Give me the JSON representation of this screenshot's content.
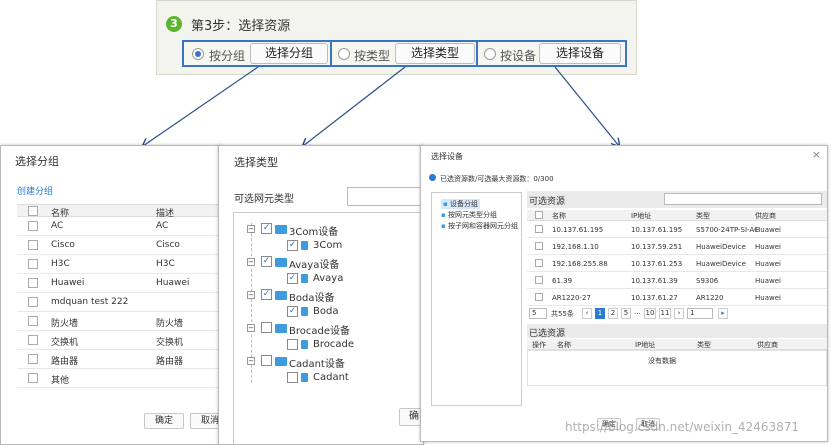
{
  "banner": {
    "step_number": "3",
    "title": "第3步：选择资源",
    "options": [
      {
        "label": "按分组",
        "button": "选择分组",
        "selected": true
      },
      {
        "label": "按类型",
        "button": "选择类型",
        "selected": false
      },
      {
        "label": "按设备",
        "button": "选择设备",
        "selected": false
      }
    ]
  },
  "group_dialog": {
    "title": "选择分组",
    "create_link": "创建分组",
    "columns": [
      "名称",
      "描述"
    ],
    "rows": [
      {
        "name": "AC",
        "desc": "AC"
      },
      {
        "name": "Cisco",
        "desc": "Cisco"
      },
      {
        "name": "H3C",
        "desc": "H3C"
      },
      {
        "name": "Huawei",
        "desc": "Huawei"
      },
      {
        "name": "mdquan test 222",
        "desc": ""
      },
      {
        "name": "防火墙",
        "desc": "防火墙"
      },
      {
        "name": "交换机",
        "desc": "交换机"
      },
      {
        "name": "路由器",
        "desc": "路由器"
      },
      {
        "name": "其他",
        "desc": ""
      }
    ],
    "ok": "确定",
    "cancel": "取消"
  },
  "type_dialog": {
    "title": "选择类型",
    "label": "可选网元类型",
    "tree": [
      {
        "folder": "3Com设备",
        "child": "3Com",
        "checked": true
      },
      {
        "folder": "Avaya设备",
        "child": "Avaya",
        "checked": true
      },
      {
        "folder": "Boda设备",
        "child": "Boda",
        "checked": true
      },
      {
        "folder": "Brocade设备",
        "child": "Brocade",
        "checked": false
      },
      {
        "folder": "Cadant设备",
        "child": "Cadant",
        "checked": false
      }
    ],
    "ok_partial": "确"
  },
  "device_dialog": {
    "title": "选择设备",
    "summary": "已选资源数/可选最大资源数：0/300",
    "left_tree": [
      "设备分组",
      "按网元类型分组",
      "按子网和容器网元分组"
    ],
    "available_label": "可选资源",
    "columns": [
      "名称",
      "IP地址",
      "类型",
      "供应商"
    ],
    "rows": [
      {
        "name": "10.137.61.195",
        "ip": "10.137.61.195",
        "type": "S5700-24TP-SI-AC",
        "vendor": "Huawei"
      },
      {
        "name": "192.168.1.10",
        "ip": "10.137.59.251",
        "type": "HuaweiDevice",
        "vendor": "Huawei"
      },
      {
        "name": "192.168.255.88",
        "ip": "10.137.61.253",
        "type": "HuaweiDevice",
        "vendor": "Huawei"
      },
      {
        "name": "61.39",
        "ip": "10.137.61.39",
        "type": "S9306",
        "vendor": "Huawei"
      },
      {
        "name": "AR1220-27",
        "ip": "10.137.61.27",
        "type": "AR1220",
        "vendor": "Huawei"
      }
    ],
    "pager": {
      "page_size": "5",
      "total": "共55条",
      "pages": [
        "1",
        "2",
        "5",
        "...",
        "10",
        "11"
      ],
      "goto": "1"
    },
    "selected_label": "已选资源",
    "selected_columns": [
      "操作",
      "名称",
      "IP地址",
      "类型",
      "供应商"
    ],
    "no_data": "没有数据",
    "ok": "确定",
    "cancel": "取消",
    "close": "×"
  },
  "watermark": "https://blog.csdn.net/weixin_42463871"
}
